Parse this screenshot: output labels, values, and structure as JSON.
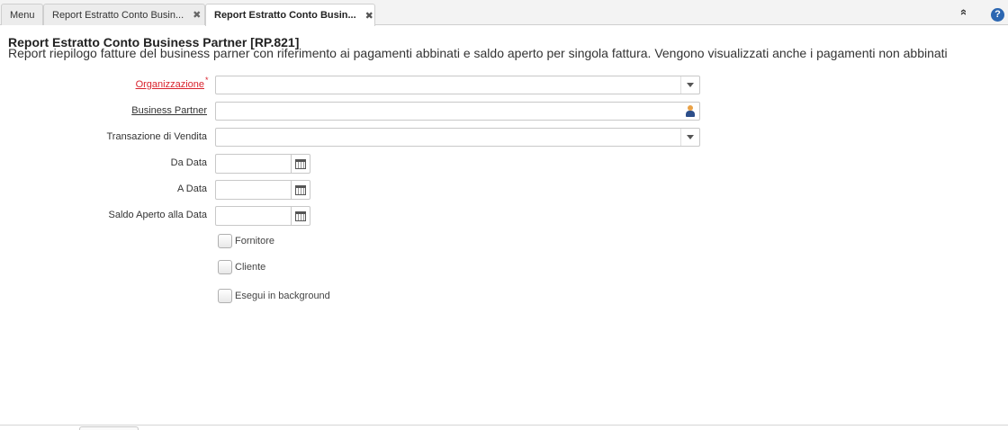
{
  "tabs": [
    {
      "label": "Menu",
      "closable": false,
      "active": false
    },
    {
      "label": "Report Estratto Conto Busin...",
      "closable": true,
      "active": false
    },
    {
      "label": "Report Estratto Conto Busin...",
      "closable": true,
      "active": true
    }
  ],
  "toolbar": {
    "collapse_icon": "double-chevron-up-icon",
    "help_icon": "help-icon",
    "help_label": "?",
    "collapse_label": "»",
    "close_label": "✖"
  },
  "header": {
    "title": "Report Estratto Conto Business Partner [RP.821]",
    "description": "Report riepilogo fatture del business parner con riferimento ai pagamenti abbinati e saldo aperto per singola fattura. Vengono visualizzati anche i pagamenti non abbinati"
  },
  "form": {
    "organizzazione": {
      "label": "Organizzazione",
      "required_marker": "*",
      "value": ""
    },
    "business_partner": {
      "label": "Business Partner",
      "value": ""
    },
    "transazione": {
      "label": "Transazione di Vendita",
      "value": ""
    },
    "da_data": {
      "label": "Da Data",
      "value": ""
    },
    "a_data": {
      "label": "A Data",
      "value": ""
    },
    "saldo_aperto": {
      "label": "Saldo Aperto alla Data",
      "value": ""
    },
    "fornitore": {
      "label": "Fornitore",
      "checked": false
    },
    "cliente": {
      "label": "Cliente",
      "checked": false
    },
    "background": {
      "label": "Esegui in background",
      "checked": false
    }
  },
  "colors": {
    "mandatory": "#d9232d",
    "help": "#2b66b1"
  }
}
